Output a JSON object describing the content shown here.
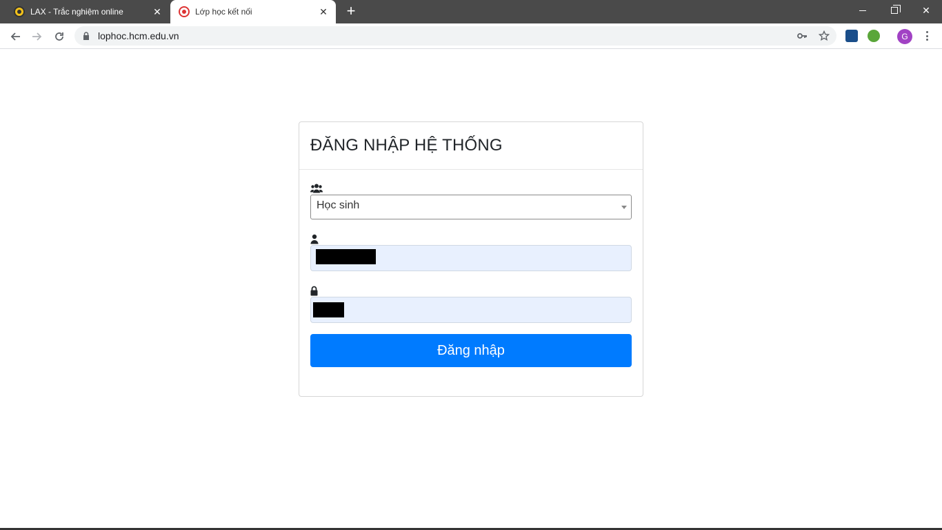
{
  "browser": {
    "tabs": [
      {
        "title": "LAX - Trắc nghiệm online",
        "active": false
      },
      {
        "title": "Lớp học kết nối",
        "active": true
      }
    ],
    "new_tab_symbol": "+",
    "close_symbol": "✕",
    "url": "lophoc.hcm.edu.vn",
    "profile_initial": "G",
    "accent_color": "#a142c4"
  },
  "login": {
    "title": "ĐĂNG NHẬP HỆ THỐNG",
    "role_icon": "users-icon",
    "role_selected": "Học sinh",
    "username_icon": "user-icon",
    "password_icon": "lock-icon",
    "submit_label": "Đăng nhập",
    "button_color": "#007bff"
  }
}
